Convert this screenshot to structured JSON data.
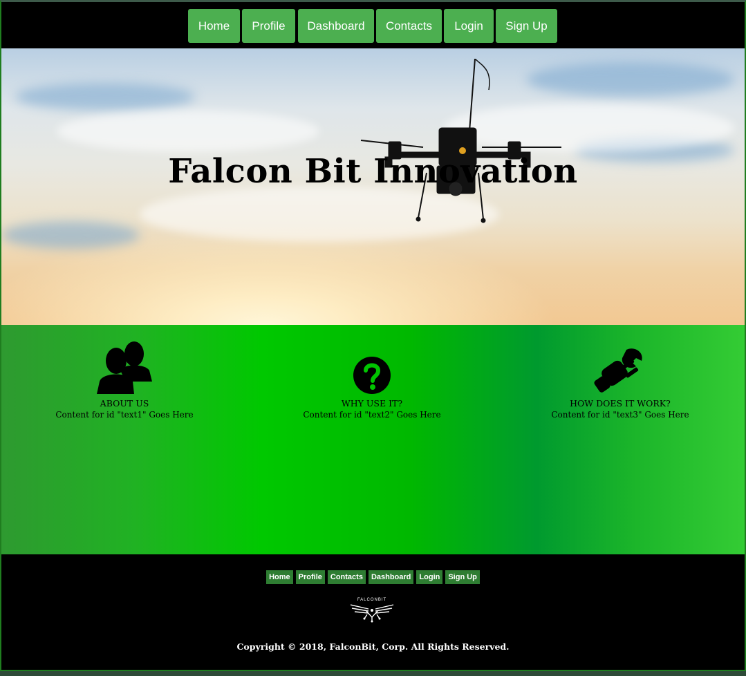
{
  "nav": {
    "items": [
      "Home",
      "Profile",
      "Dashboard",
      "Contacts",
      "Login",
      "Sign Up"
    ]
  },
  "hero": {
    "title": "Falcon Bit Innovation"
  },
  "features": [
    {
      "icon": "users-icon",
      "title": "ABOUT US",
      "text": "Content for id \"text1\" Goes Here"
    },
    {
      "icon": "question-circle-icon",
      "title": "WHY USE IT?",
      "text": "Content for id \"text2\" Goes Here"
    },
    {
      "icon": "plug-wrench-icon",
      "title": "HOW DOES IT WORK?",
      "text": "Content for id \"text3\" Goes Here"
    }
  ],
  "footer": {
    "nav": [
      "Home",
      "Profile",
      "Contacts",
      "Dashboard",
      "Login",
      "Sign Up"
    ],
    "logo_text": "FALCONBIT",
    "copyright": "Copyright © 2018, FalconBit, Corp. All Rights Reserved."
  },
  "colors": {
    "nav_button": "#4caf50",
    "footer_button": "#2e7d32",
    "feature_band": "#00c800"
  }
}
